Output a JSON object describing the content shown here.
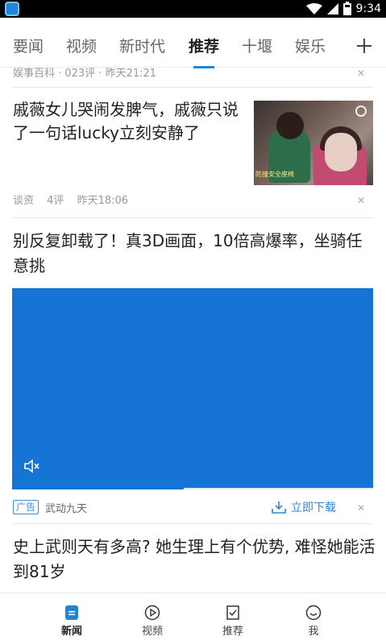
{
  "status_bar": {
    "time": "9:34"
  },
  "tabs": [
    {
      "label": "要闻"
    },
    {
      "label": "视频"
    },
    {
      "label": "新时代"
    },
    {
      "label": "推荐"
    },
    {
      "label": "十堰"
    },
    {
      "label": "娱乐"
    }
  ],
  "active_tab": "推荐",
  "feed": {
    "cut_item": {
      "meta": "娱事百科 · 023评 · 昨天21:21"
    },
    "article1": {
      "title": "戚薇女儿哭闹发脾气，戚薇只说了一句话lucky立刻安静了",
      "thumb_caption": "防撞安全座椅",
      "source": "谈资",
      "comments": "4评",
      "time": "昨天18:06"
    },
    "ad": {
      "title": "别反复卸载了！真3D画面，10倍高爆率，坐骑任意挑",
      "badge": "广告",
      "advertiser": "武动九天",
      "download_label": "立即下载",
      "video_color": "#1574d4"
    },
    "article2": {
      "title": "史上武则天有多高? 她生理上有个优势, 难怪她能活到81岁"
    }
  },
  "bottom_nav": [
    {
      "label": "新闻",
      "icon": "news-icon"
    },
    {
      "label": "视频",
      "icon": "play-circle-icon"
    },
    {
      "label": "推荐",
      "icon": "checkbox-icon"
    },
    {
      "label": "我",
      "icon": "smile-icon"
    }
  ],
  "colors": {
    "accent": "#1f86d6"
  }
}
